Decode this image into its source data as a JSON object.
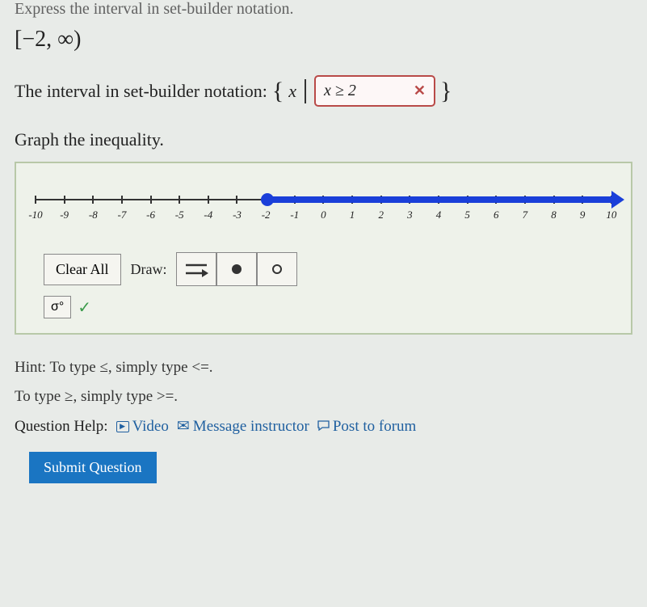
{
  "prompt": "Express the interval in set-builder notation.",
  "interval_expr": "[−2, ∞)",
  "answer_label": "The interval in set-builder notation:",
  "set_open": "{",
  "set_var": "x",
  "set_close": "}",
  "user_answer": "x ≥ 2",
  "graph_prompt": "Graph the inequality.",
  "numberline": {
    "min": -10,
    "max": 10,
    "ticks": [
      "-10",
      "-9",
      "-8",
      "-7",
      "-6",
      "-5",
      "-4",
      "-3",
      "-2",
      "-1",
      "0",
      "1",
      "2",
      "3",
      "4",
      "5",
      "6",
      "7",
      "8",
      "9",
      "10"
    ],
    "ray_start": -2,
    "ray_end": 10,
    "closed_start": true,
    "arrow_right": true
  },
  "clear_all": "Clear All",
  "draw_label": "Draw:",
  "hint1_pre": "Hint: To type ",
  "hint1_sym": "≤",
  "hint1_post": ", simply type <=.",
  "hint2_pre": "To type ",
  "hint2_sym": "≥",
  "hint2_post": ", simply type >=.",
  "help_label": "Question Help:",
  "video": "Video",
  "message": "Message instructor",
  "forum": "Post to forum",
  "submit": "Submit Question",
  "chart_data": {
    "type": "numberline",
    "axis_range": [
      -10,
      10
    ],
    "tick_interval": 1,
    "intervals": [
      {
        "start": -2,
        "end": "inf",
        "left_closed": true,
        "right_closed": false
      }
    ],
    "title": "Graph the inequality."
  }
}
